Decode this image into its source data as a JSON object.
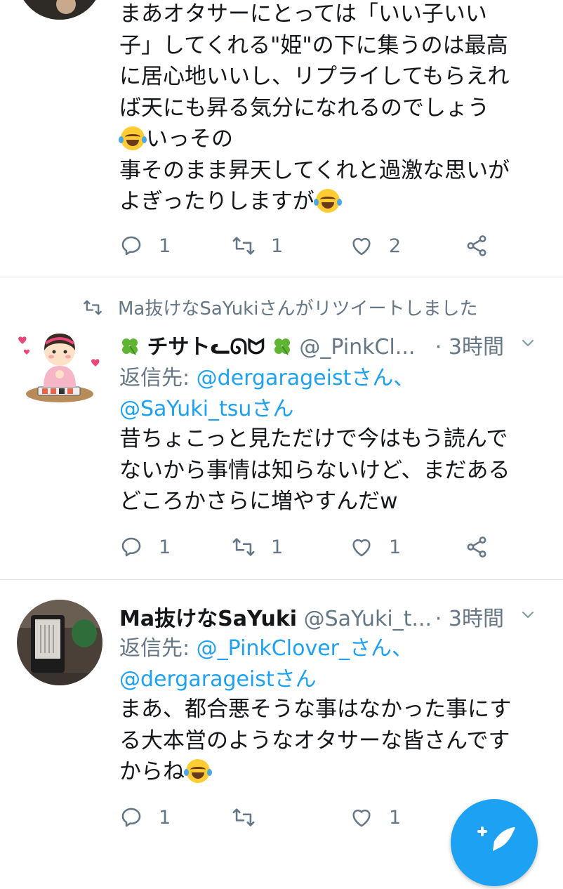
{
  "tweet1": {
    "lines": [
      "まあオタサーにとっては「いい子いい",
      "子」してくれる\"姫\"の下に集うのは最高",
      "に居心地いいし、リプライしてもらえれ",
      "ば天にも昇る気分になれるのでしょう"
    ],
    "line5": "いっその",
    "line6": "事そのまま昇天してくれと過激な思いが",
    "line7": "よぎったりしますが",
    "reply_count": "1",
    "retweet_count": "1",
    "like_count": "2"
  },
  "tweet2": {
    "retweet_context": "Ma抜けなSaYukiさんがリツイートしました",
    "name": "チサト",
    "name_suffix": "ᓚᘏᗢ",
    "handle": "@_PinkCl...",
    "time": "· 3時間",
    "reply_label": "返信先: ",
    "reply_mention1": "@dergarageistさん、",
    "reply_mention2": "@SaYuki_tsuさん",
    "lines": [
      "昔ちょこっと見ただけで今はもう読んで",
      "ないから事情は知らないけど、まだある",
      "どころかさらに増やすんだw"
    ],
    "reply_count": "1",
    "retweet_count": "1",
    "like_count": "1"
  },
  "tweet3": {
    "name": "Ma抜けなSaYuki",
    "handle": "@SaYuki_t...",
    "time": "· 3時間",
    "reply_label": "返信先: ",
    "reply_mention1": "@_PinkClover_さん、",
    "reply_mention2": "@dergarageistさん",
    "lines": [
      "まあ、都合悪そうな事はなかった事にす",
      "る大本営のようなオタサーな皆さんです"
    ],
    "line3": "からね",
    "reply_count": "1",
    "like_count": "1"
  },
  "colors": {
    "accent": "#1da1f2",
    "muted": "#657786",
    "divider": "#e1e8ed"
  },
  "icons": [
    "reply-icon",
    "retweet-icon",
    "like-icon",
    "share-icon",
    "chevron-down-icon",
    "compose-icon",
    "clover-icon",
    "laughing-tears-emoji"
  ]
}
